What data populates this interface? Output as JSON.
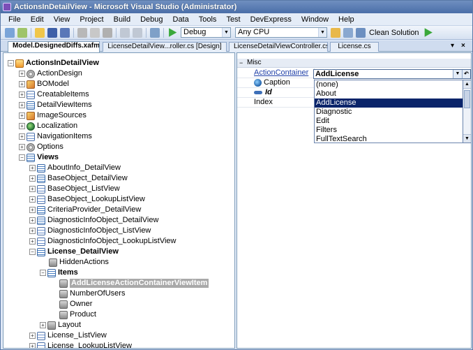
{
  "window": {
    "title": "ActionsInDetailView - Microsoft Visual Studio (Administrator)"
  },
  "menu": [
    "File",
    "Edit",
    "View",
    "Project",
    "Build",
    "Debug",
    "Data",
    "Tools",
    "Test",
    "DevExpress",
    "Window",
    "Help"
  ],
  "toolbar": {
    "config": "Debug",
    "platform": "Any CPU",
    "clean_label": "Clean Solution"
  },
  "tabs": [
    {
      "label": "Model.DesignedDiffs.xafml",
      "active": true
    },
    {
      "label": "LicenseDetailView...roller.cs [Design]",
      "active": false
    },
    {
      "label": "LicenseDetailViewController.cs",
      "active": false
    },
    {
      "label": "License.cs",
      "active": false
    }
  ],
  "tab_controls": {
    "dropdown": "▾",
    "close": "×"
  },
  "tree": {
    "root": "ActionsInDetailView",
    "nodes": [
      {
        "label": "ActionDesign"
      },
      {
        "label": "BOModel"
      },
      {
        "label": "CreatableItems"
      },
      {
        "label": "DetailViewItems"
      },
      {
        "label": "ImageSources"
      },
      {
        "label": "Localization"
      },
      {
        "label": "NavigationItems"
      },
      {
        "label": "Options"
      },
      {
        "label": "Views"
      },
      {
        "label": "AboutInfo_DetailView"
      },
      {
        "label": "BaseObject_DetailView"
      },
      {
        "label": "BaseObject_ListView"
      },
      {
        "label": "BaseObject_LookupListView"
      },
      {
        "label": "CriteriaProvider_DetailView"
      },
      {
        "label": "DiagnosticInfoObject_DetailView"
      },
      {
        "label": "DiagnosticInfoObject_ListView"
      },
      {
        "label": "DiagnosticInfoObject_LookupListView"
      },
      {
        "label": "License_DetailView"
      },
      {
        "label": "HiddenActions"
      },
      {
        "label": "Items"
      },
      {
        "label": "AddLicenseActionContainerViewItem"
      },
      {
        "label": "NumberOfUsers"
      },
      {
        "label": "Owner"
      },
      {
        "label": "Product"
      },
      {
        "label": "Layout"
      },
      {
        "label": "License_ListView"
      },
      {
        "label": "License_LookupListView"
      }
    ]
  },
  "properties": {
    "category": "Misc",
    "rows": [
      {
        "name": "ActionContainer",
        "value": "AddLicense"
      },
      {
        "name": "Caption",
        "value": ""
      },
      {
        "name": "Id",
        "value": ""
      },
      {
        "name": "Index",
        "value": ""
      }
    ],
    "dropdown_items": [
      "(none)",
      "About",
      "AddLicense",
      "Diagnostic",
      "Edit",
      "Filters",
      "FullTextSearch"
    ],
    "selected_item": "AddLicense"
  },
  "colors": {
    "titlebar": "#4a6ea8",
    "selection": "#0a246a",
    "tree_selected": "#a9a9a9"
  }
}
